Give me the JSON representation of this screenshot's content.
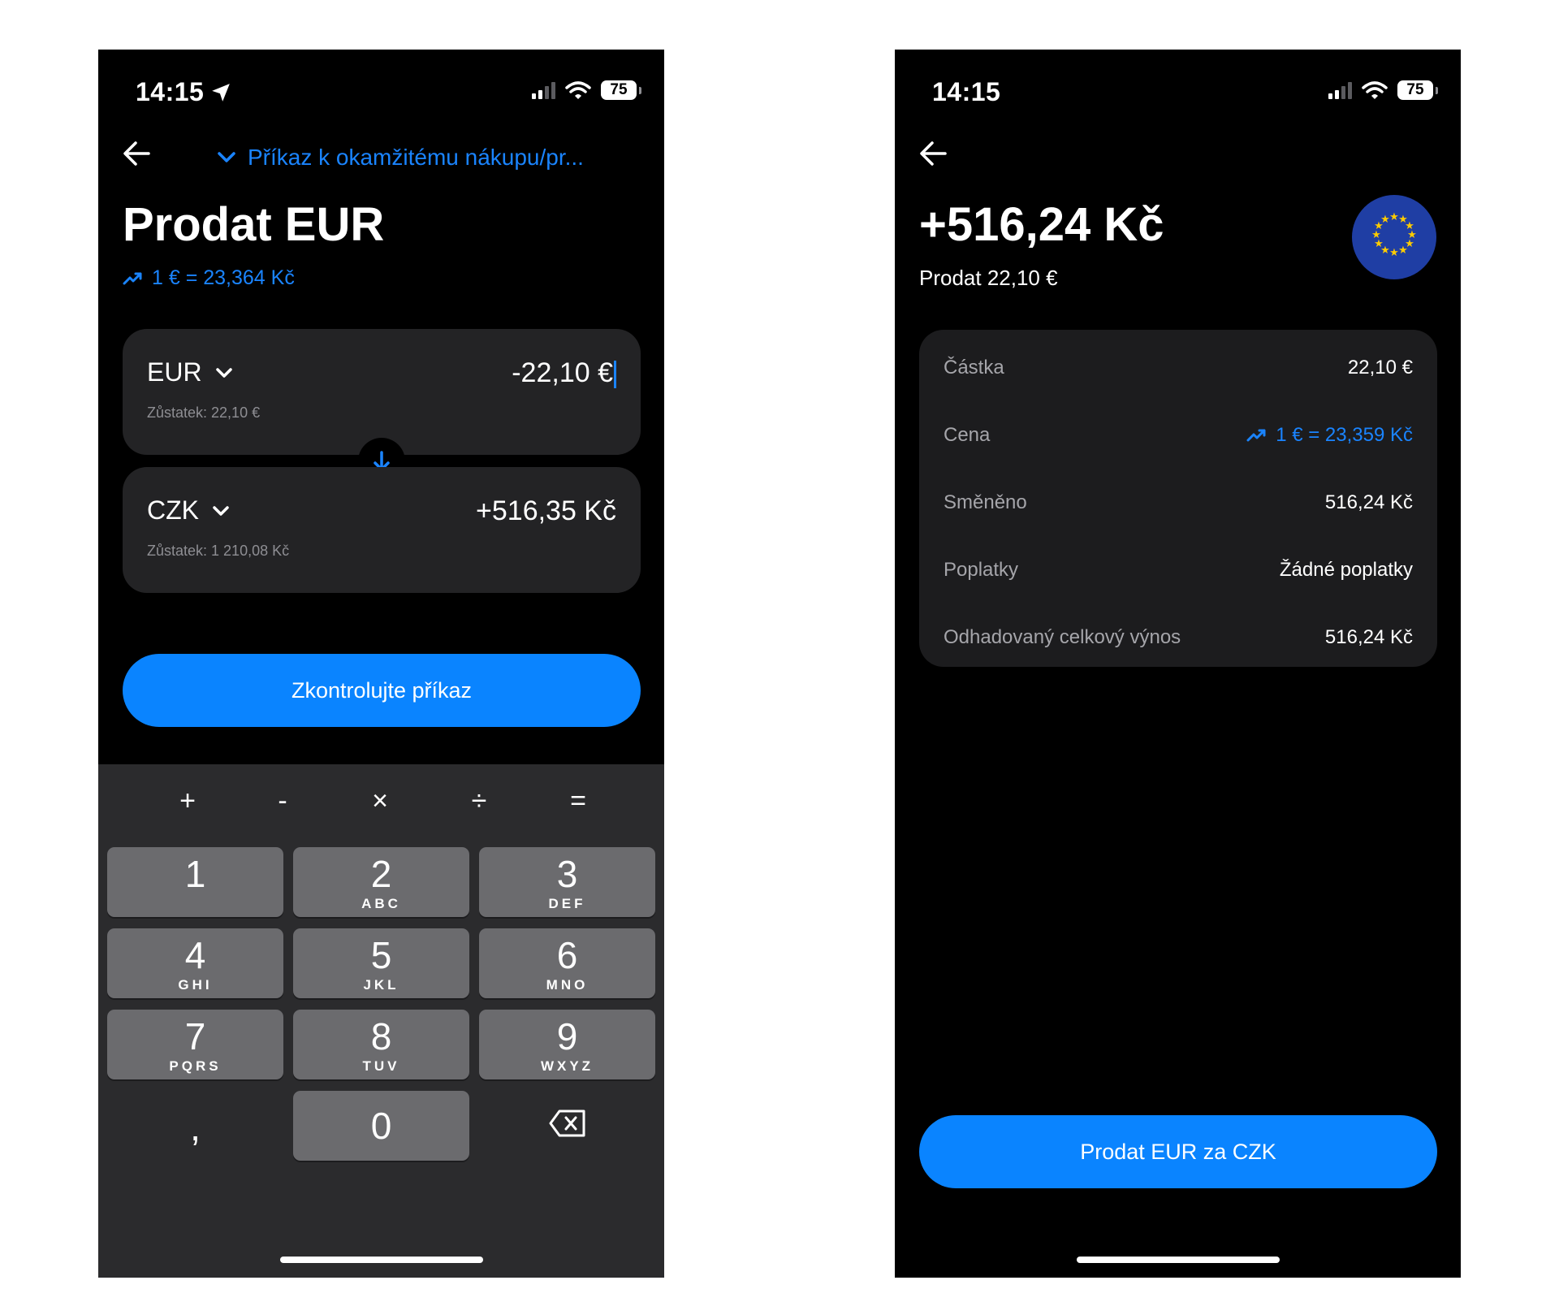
{
  "left_screen": {
    "status": {
      "time": "14:15",
      "battery": "75"
    },
    "header": {
      "dropdown_label": "Příkaz k okamžitému nákupu/pr..."
    },
    "title": "Prodat EUR",
    "rate": "1 € = 23,364 Kč",
    "from": {
      "currency": "EUR",
      "amount": "-22,10 €",
      "balance": "Zůstatek: 22,10 €"
    },
    "to": {
      "currency": "CZK",
      "amount": "+516,35 Kč",
      "balance": "Zůstatek: 1 210,08 Kč"
    },
    "review_button": "Zkontrolujte příkaz",
    "keyboard": {
      "operators": [
        "+",
        "-",
        "×",
        "÷",
        "="
      ],
      "keys": [
        {
          "num": "1",
          "letters": ""
        },
        {
          "num": "2",
          "letters": "ABC"
        },
        {
          "num": "3",
          "letters": "DEF"
        },
        {
          "num": "4",
          "letters": "GHI"
        },
        {
          "num": "5",
          "letters": "JKL"
        },
        {
          "num": "6",
          "letters": "MNO"
        },
        {
          "num": "7",
          "letters": "PQRS"
        },
        {
          "num": "8",
          "letters": "TUV"
        },
        {
          "num": "9",
          "letters": "WXYZ"
        }
      ],
      "comma": ",",
      "zero": "0"
    }
  },
  "right_screen": {
    "status": {
      "time": "14:15",
      "battery": "75"
    },
    "amount": "+516,24 Kč",
    "subtitle": "Prodat 22,10 €",
    "details": [
      {
        "label": "Částka",
        "value": "22,10 €"
      },
      {
        "label": "Cena",
        "value": "1 € = 23,359 Kč"
      },
      {
        "label": "Směněno",
        "value": "516,24 Kč"
      },
      {
        "label": "Poplatky",
        "value": "Žádné poplatky"
      },
      {
        "label": "Odhadovaný celkový výnos",
        "value": "516,24 Kč"
      }
    ],
    "sell_button": "Prodat EUR za CZK"
  },
  "colors": {
    "accent": "#0a84ff",
    "background": "#000000",
    "card": "#232325",
    "eu_flag": "#1f3ea4"
  },
  "icons": [
    "location-arrow-icon",
    "signal-icon",
    "wifi-icon",
    "battery-icon",
    "back-arrow-icon",
    "chevron-down-icon",
    "trend-up-icon",
    "arrow-down-icon",
    "backspace-icon",
    "eu-flag-icon"
  ]
}
